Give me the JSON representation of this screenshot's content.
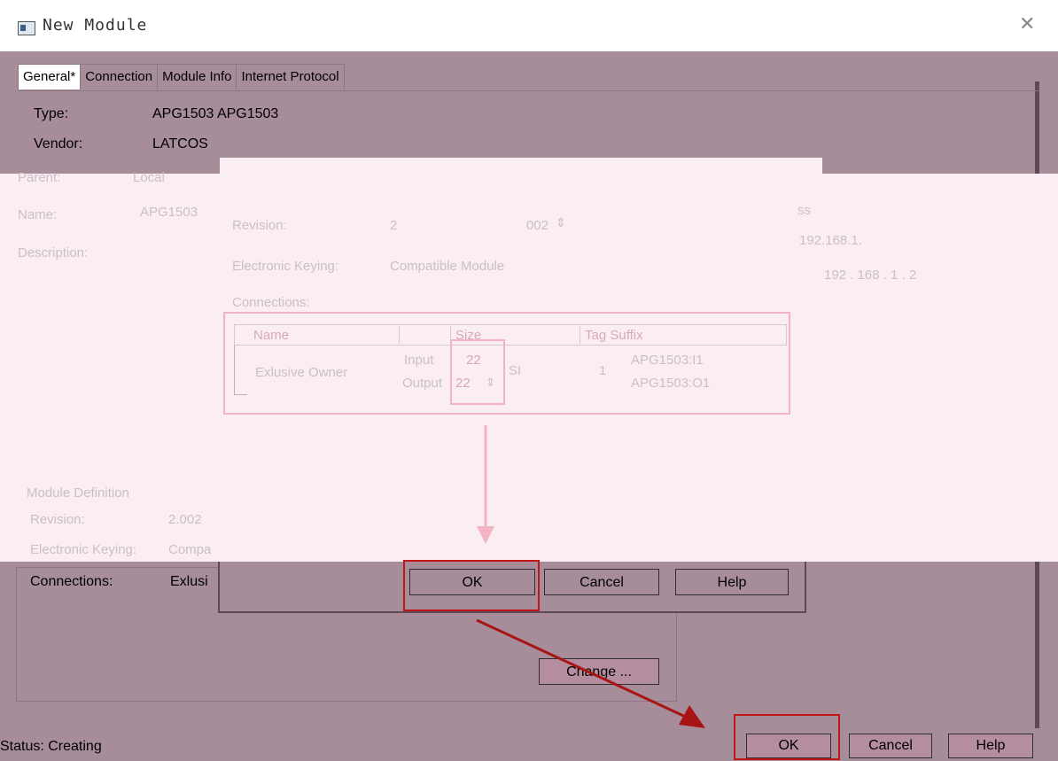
{
  "window": {
    "title": "New Module",
    "close_glyph": "✕"
  },
  "tabs": [
    {
      "label": "General*",
      "active": true
    },
    {
      "label": "Connection"
    },
    {
      "label": "Module Info"
    },
    {
      "label": "Internet Protocol"
    }
  ],
  "general": {
    "type_label": "Type:",
    "type_value": "APG1503 APG1503",
    "vendor_label": "Vendor:",
    "vendor_value": "LATCOS",
    "parent_label": "Parent:",
    "parent_value": "Local",
    "name_label": "Name:",
    "name_value": "APG1503",
    "description_label": "Description:"
  },
  "right_fragments": {
    "address_label": "ss",
    "ip_fragment_1": "192.168.1.",
    "ip_fragment_2": "192 . 168 . 1 . 2"
  },
  "revision_dialog": {
    "revision_label": "Revision:",
    "revision_major": "2",
    "revision_minor": "002",
    "keying_label": "Electronic Keying:",
    "keying_value": "Compatible Module",
    "connections_label": "Connections:",
    "table": {
      "headers": [
        "Name",
        "",
        "Size",
        "Tag Suffix"
      ],
      "row": {
        "name": "Exlusive Owner",
        "input_label": "Input",
        "input_size": "22",
        "output_label": "Output",
        "output_size": "22",
        "unit": "SI",
        "count": "1",
        "tag_input": "APG1503:I1",
        "tag_output": "APG1503:O1"
      }
    },
    "buttons": {
      "ok": "OK",
      "cancel": "Cancel",
      "help": "Help"
    }
  },
  "module_definition": {
    "group_label": "Module Definition",
    "revision_label": "Revision:",
    "revision_value": "2.002",
    "keying_label": "Electronic Keying:",
    "keying_value": "Compa",
    "connections_label": "Connections:",
    "connections_value": "Exlusi",
    "change_button": "Change ..."
  },
  "status": {
    "text": "Status: Creating"
  },
  "footer_buttons": {
    "ok": "OK",
    "cancel": "Cancel",
    "help": "Help"
  },
  "colors": {
    "dialog_bg": "#a78c9a",
    "overlay_bg": "#fbeef2",
    "highlight_pink": "#f2b3c4",
    "highlight_red": "#c21616",
    "arrow_red": "#a81414"
  }
}
